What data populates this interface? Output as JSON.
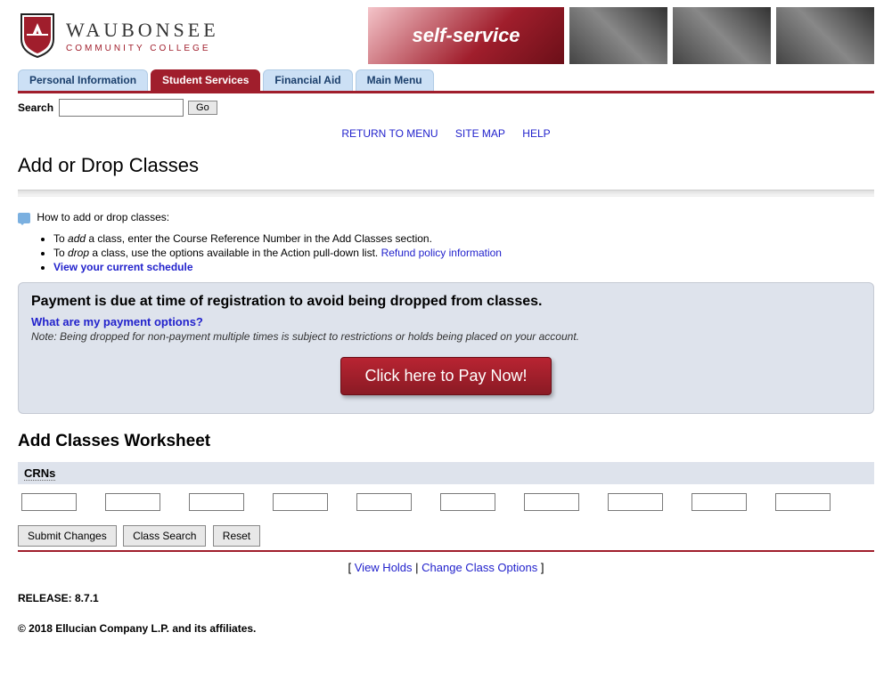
{
  "logo": {
    "title": "WAUBONSEE",
    "subtitle": "COMMUNITY COLLEGE"
  },
  "banner": {
    "text": "self-service"
  },
  "tabs": [
    {
      "label": "Personal Information",
      "active": false
    },
    {
      "label": "Student Services",
      "active": true
    },
    {
      "label": "Financial Aid",
      "active": false
    },
    {
      "label": "Main Menu",
      "active": false
    }
  ],
  "search": {
    "label": "Search",
    "go": "Go",
    "value": ""
  },
  "nav": {
    "return": "RETURN TO MENU",
    "sitemap": "SITE MAP",
    "help": "HELP"
  },
  "page": {
    "title": "Add or Drop Classes",
    "howto_label": "How to add or drop classes:",
    "bullet1_pre": "To ",
    "bullet1_em": "add",
    "bullet1_post": " a class, enter the Course Reference Number in the Add Classes section.",
    "bullet2_pre": "To ",
    "bullet2_em": "drop",
    "bullet2_post": " a class, use the options available in the Action pull-down list. ",
    "bullet2_link": "Refund policy information",
    "bullet3_link": "View your current schedule",
    "notice_title": "Payment is due at time of registration to avoid being dropped from classes.",
    "notice_link": "What are my payment options?",
    "notice_note": "Note: Being dropped for non-payment multiple times is subject to restrictions or holds being placed on your account.",
    "pay_btn": "Click here to Pay Now!",
    "worksheet_title": "Add Classes Worksheet",
    "crn_label": "CRNs",
    "crn_count": 10,
    "submit": "Submit Changes",
    "class_search": "Class Search",
    "reset": "Reset"
  },
  "footer": {
    "lb": "[ ",
    "view_holds": "View Holds",
    "sep": " | ",
    "change_opts": "Change Class Options",
    "rb": " ]",
    "release": "RELEASE: 8.7.1",
    "copyright": "© 2018 Ellucian Company L.P. and its affiliates."
  }
}
